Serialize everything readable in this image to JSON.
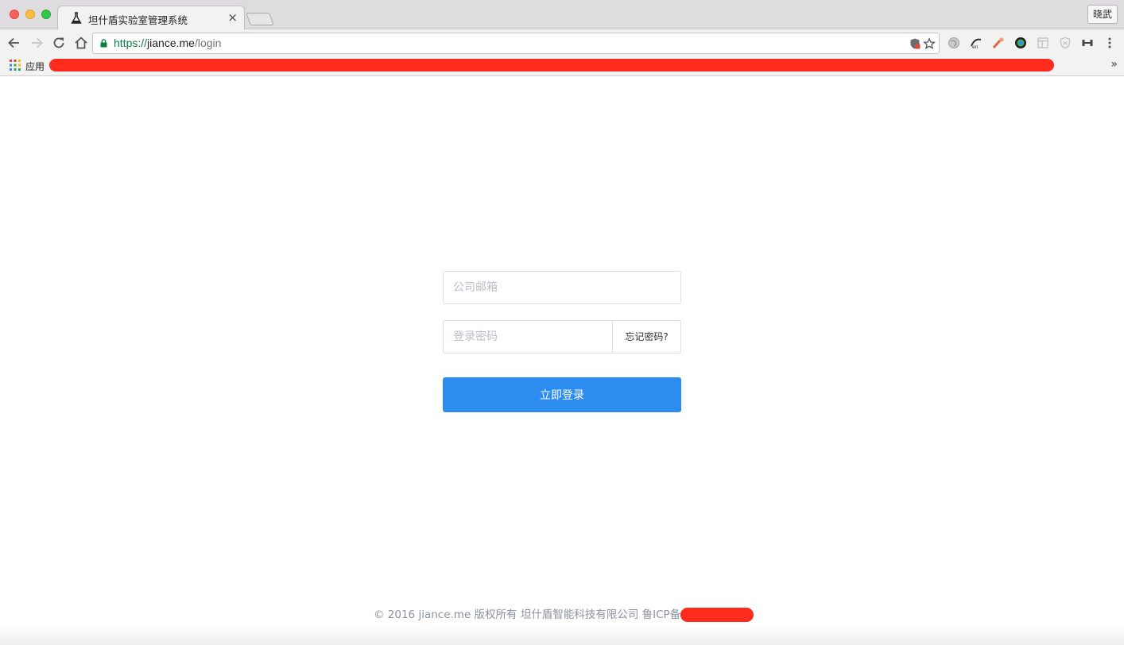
{
  "browser": {
    "tab": {
      "title": "坦什盾实验室管理系统",
      "close_glyph": "×",
      "icon": "flask-icon"
    },
    "profile_name": "晓武",
    "address_bar": {
      "scheme": "https://",
      "host": "jiance.me",
      "path": "/login"
    },
    "bookmarks": {
      "apps_label": "应用",
      "overflow_glyph": "»"
    },
    "colors": {
      "secure_green": "#0b8043",
      "redaction": "#ff2b1f"
    }
  },
  "login": {
    "email_placeholder": "公司邮箱",
    "email_value": "",
    "password_placeholder": "登录密码",
    "password_value": "",
    "forgot_label": "忘记密码?",
    "submit_label": "立即登录",
    "accent_color": "#2d8cf0"
  },
  "footer": {
    "text": "© 2016 jiance.me 版权所有 坦什盾智能科技有限公司 鲁ICP备"
  }
}
